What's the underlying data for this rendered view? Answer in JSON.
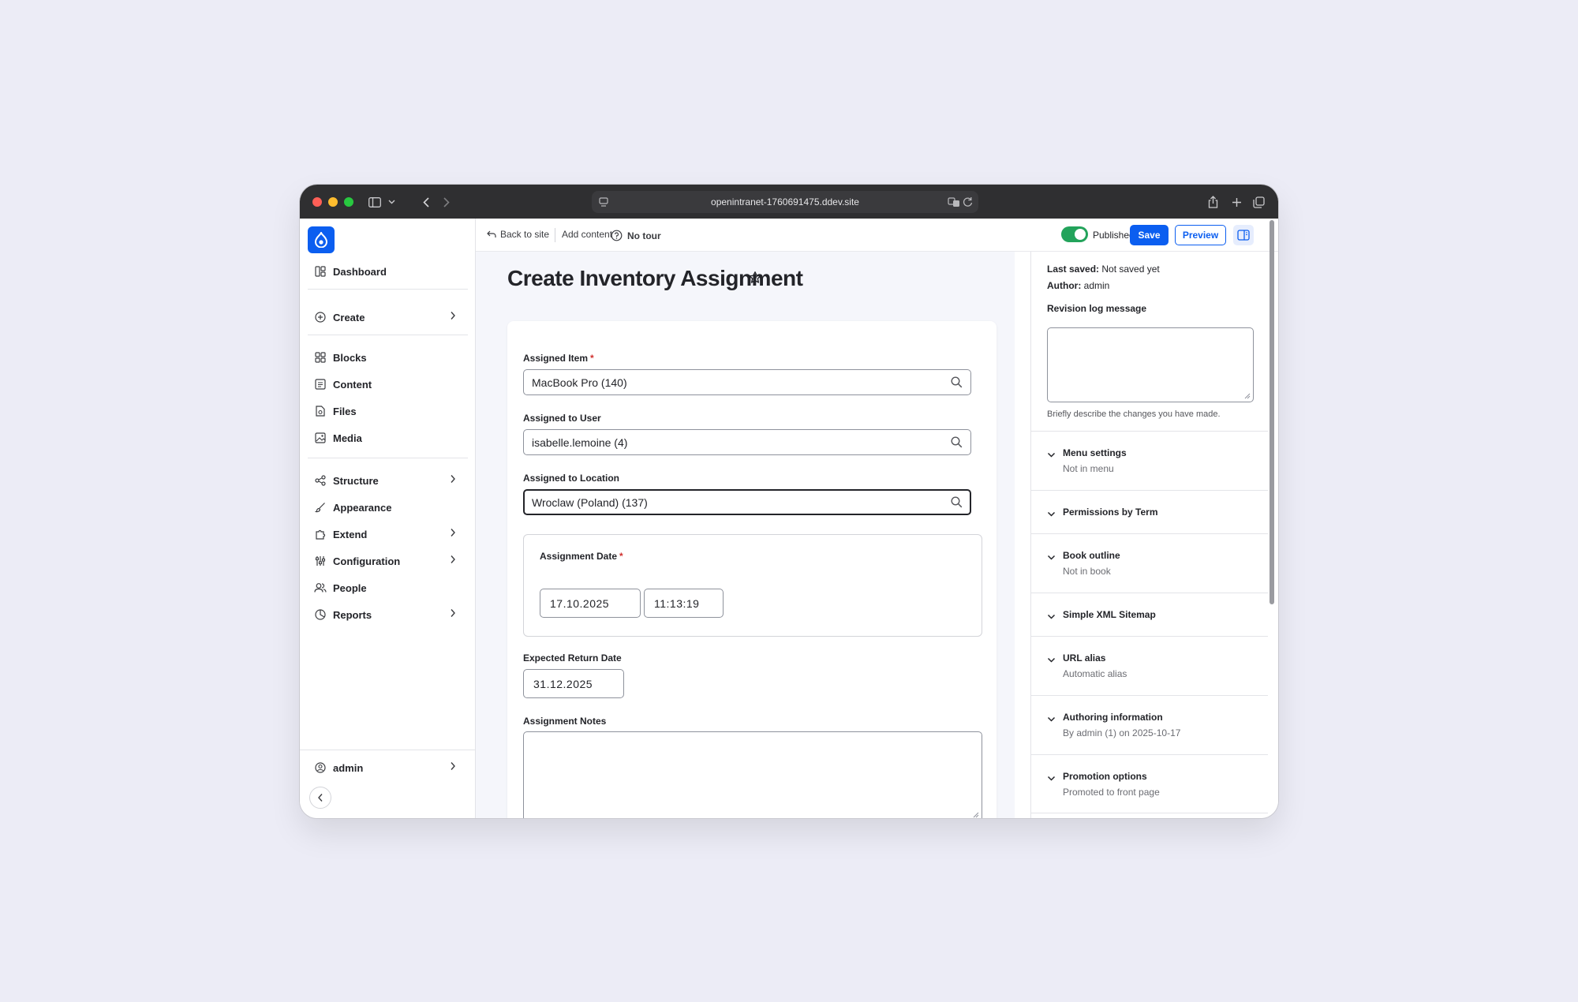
{
  "browser": {
    "url": "openintranet-1760691475.ddev.site"
  },
  "sidebar": {
    "items": [
      {
        "label": "Dashboard",
        "icon": "dashboard-icon",
        "chevron": false
      },
      {
        "label": "Create",
        "icon": "plus-circle-icon",
        "chevron": true
      },
      {
        "label": "Blocks",
        "icon": "blocks-icon",
        "chevron": false
      },
      {
        "label": "Content",
        "icon": "content-icon",
        "chevron": false
      },
      {
        "label": "Files",
        "icon": "file-icon",
        "chevron": false
      },
      {
        "label": "Media",
        "icon": "media-icon",
        "chevron": false
      },
      {
        "label": "Structure",
        "icon": "structure-icon",
        "chevron": true
      },
      {
        "label": "Appearance",
        "icon": "brush-icon",
        "chevron": false
      },
      {
        "label": "Extend",
        "icon": "puzzle-icon",
        "chevron": true
      },
      {
        "label": "Configuration",
        "icon": "sliders-icon",
        "chevron": true
      },
      {
        "label": "People",
        "icon": "people-icon",
        "chevron": false
      },
      {
        "label": "Reports",
        "icon": "chart-pie-icon",
        "chevron": true
      }
    ],
    "user": "admin"
  },
  "toolbar": {
    "back_to_site": "Back to site",
    "add_content": "Add content",
    "no_tour": "No tour",
    "published": "Published",
    "published_on": true,
    "save": "Save",
    "preview": "Preview"
  },
  "page": {
    "title": "Create Inventory Assignment"
  },
  "form": {
    "assigned_item": {
      "label": "Assigned Item",
      "value": "MacBook Pro (140)",
      "required": "*"
    },
    "assigned_user": {
      "label": "Assigned to User",
      "value": "isabelle.lemoine (4)"
    },
    "assigned_location": {
      "label": "Assigned to Location",
      "value": "Wroclaw (Poland) (137)"
    },
    "assignment_date": {
      "label": "Assignment Date",
      "required": "*",
      "date": "17.10.2025",
      "time": "11:13:19"
    },
    "expected_return": {
      "label": "Expected Return Date",
      "date": "31.12.2025"
    },
    "notes": {
      "label": "Assignment Notes",
      "value": ""
    }
  },
  "meta": {
    "last_saved_label": "Last saved:",
    "last_saved_value": "Not saved yet",
    "author_label": "Author:",
    "author_value": "admin",
    "revision_label": "Revision log message",
    "revision_help": "Briefly describe the changes you have made.",
    "sections": [
      {
        "title": "Menu settings",
        "sub": "Not in menu"
      },
      {
        "title": "Permissions by Term",
        "sub": ""
      },
      {
        "title": "Book outline",
        "sub": "Not in book"
      },
      {
        "title": "Simple XML Sitemap",
        "sub": ""
      },
      {
        "title": "URL alias",
        "sub": "Automatic alias"
      },
      {
        "title": "Authoring information",
        "sub": "By admin (1) on 2025-10-17"
      },
      {
        "title": "Promotion options",
        "sub": "Promoted to front page"
      }
    ]
  },
  "colors": {
    "accent": "#0b5ef0",
    "published_toggle": "#23a35b",
    "required": "#d0302e"
  }
}
